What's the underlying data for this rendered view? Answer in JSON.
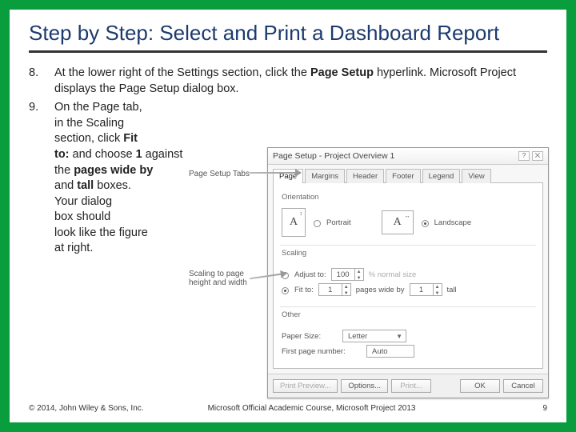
{
  "title": "Step by Step: Select and Print a Dashboard Report",
  "steps": {
    "s8": {
      "num": "8.",
      "text_pre": "At the lower right of the Settings section, click the ",
      "b1": "Page Setup",
      "text_post": " hyperlink. Microsoft Project displays the Page Setup dialog box."
    },
    "s9": {
      "num": "9.",
      "l1": "On the Page tab,",
      "l2": "in the Scaling",
      "l3_pre": "section, click ",
      "l3_b": "Fit",
      "l4_b1": "to:",
      "l4_mid": " and choose ",
      "l4_b2": "1",
      "l4_post": " against",
      "l5_pre": "the ",
      "l5_b": "pages wide by",
      "l6_pre": "and ",
      "l6_b": "tall",
      "l6_post": " boxes.",
      "l7": "Your dialog",
      "l8": "box should",
      "l9": "look like the figure",
      "l10": "at right."
    }
  },
  "callouts": {
    "c1": "Page Setup Tabs",
    "c2a": "Scaling to page",
    "c2b": "height and width"
  },
  "dialog": {
    "title": "Page Setup - Project Overview 1",
    "help": "?",
    "close": "⨉",
    "tabs": [
      "Page",
      "Margins",
      "Header",
      "Footer",
      "Legend",
      "View"
    ],
    "orientation_label": "Orientation",
    "portrait": "Portrait",
    "landscape": "Landscape",
    "letterA": "A",
    "scaling_label": "Scaling",
    "adjust_label": "Adjust to:",
    "adjust_val": "100",
    "adjust_suffix": "% normal size",
    "fit_label": "Fit to:",
    "fit_w": "1",
    "fit_mid": "pages wide by",
    "fit_h": "1",
    "fit_tall": "tall",
    "other_label": "Other",
    "paper_label": "Paper Size:",
    "paper_val": "Letter",
    "firstpg_label": "First page number:",
    "firstpg_val": "Auto",
    "btn_preview": "Print Preview...",
    "btn_options": "Options...",
    "btn_print": "Print...",
    "btn_ok": "OK",
    "btn_cancel": "Cancel"
  },
  "footer": {
    "left": "© 2014, John Wiley & Sons, Inc.",
    "center": "Microsoft Official Academic Course, Microsoft Project 2013",
    "page": "9"
  }
}
